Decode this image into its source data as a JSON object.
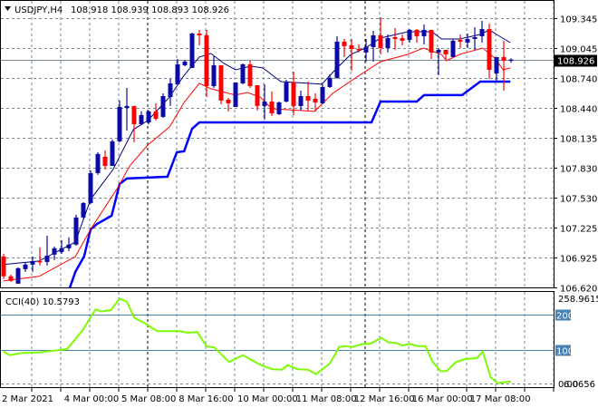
{
  "header": {
    "symbol": "USDJPY,H4",
    "ohlc": "108.918 108.939 108.893 108.926",
    "current_price": "108.926"
  },
  "colors": {
    "bull": "#0a0aa8",
    "bear": "#ff0000",
    "ma_fast": "#000080",
    "ma_slow": "#ff0000",
    "stop_line": "#0000ff",
    "cci": "#7cfc00",
    "level": "#4682b4",
    "grid": "#778899"
  },
  "chart_data": [
    {
      "type": "candlestick",
      "title": "USDJPY,H4",
      "yticks": [
        "109.345",
        "109.045",
        "108.740",
        "108.440",
        "108.135",
        "107.830",
        "107.530",
        "107.225",
        "106.925",
        "106.620"
      ],
      "ylim": [
        106.62,
        109.345
      ],
      "xticks": [
        "2 Mar 2021",
        "4 Mar 00:00",
        "5 Mar 08:00",
        "8 Mar 16:00",
        "10 Mar 00:00",
        "11 Mar 08:00",
        "12 Mar 16:00",
        "16 Mar 00:00",
        "17 Mar 08:00"
      ],
      "grid": true,
      "candles": [
        [
          106.933,
          106.961,
          106.704,
          106.732
        ],
        [
          106.732,
          106.75,
          106.677,
          106.686
        ],
        [
          106.658,
          106.823,
          106.658,
          106.814
        ],
        [
          106.805,
          106.869,
          106.777,
          106.851
        ],
        [
          106.851,
          106.933,
          106.777,
          106.887
        ],
        [
          106.887,
          107.025,
          106.842,
          106.878
        ],
        [
          106.878,
          107.144,
          106.842,
          106.942
        ],
        [
          106.952,
          107.034,
          106.897,
          107.016
        ],
        [
          106.979,
          107.098,
          106.961,
          107.016
        ],
        [
          107.016,
          107.126,
          106.988,
          107.053
        ],
        [
          107.053,
          107.355,
          107.043,
          107.328
        ],
        [
          107.328,
          107.483,
          107.319,
          107.474
        ],
        [
          107.474,
          107.804,
          107.465,
          107.777
        ],
        [
          107.777,
          107.988,
          107.759,
          107.97
        ],
        [
          107.942,
          108.006,
          107.814,
          107.85
        ],
        [
          107.85,
          108.116,
          107.85,
          108.098
        ],
        [
          108.098,
          108.511,
          108.089,
          108.446
        ],
        [
          108.437,
          108.639,
          108.208,
          108.456
        ],
        [
          108.456,
          108.456,
          108.089,
          108.272
        ],
        [
          108.272,
          108.401,
          108.263,
          108.364
        ],
        [
          108.29,
          108.41,
          108.272,
          108.401
        ],
        [
          108.401,
          108.483,
          108.309,
          108.327
        ],
        [
          108.346,
          108.584,
          108.336,
          108.556
        ],
        [
          108.547,
          108.731,
          108.456,
          108.685
        ],
        [
          108.676,
          108.932,
          108.676,
          108.877
        ],
        [
          108.868,
          108.923,
          108.859,
          108.905
        ],
        [
          108.841,
          109.198,
          108.841,
          109.189
        ],
        [
          109.189,
          109.226,
          109.07,
          109.171
        ],
        [
          109.171,
          109.226,
          108.547,
          108.657
        ],
        [
          108.657,
          108.96,
          108.639,
          108.868
        ],
        [
          108.868,
          108.868,
          108.474,
          108.511
        ],
        [
          108.52,
          108.538,
          108.401,
          108.483
        ],
        [
          108.446,
          108.694,
          108.446,
          108.694
        ],
        [
          108.685,
          108.886,
          108.676,
          108.877
        ],
        [
          108.877,
          108.914,
          108.639,
          108.657
        ],
        [
          108.666,
          108.666,
          108.41,
          108.456
        ],
        [
          108.456,
          108.676,
          108.318,
          108.501
        ],
        [
          108.501,
          108.602,
          108.355,
          108.382
        ],
        [
          108.373,
          108.501,
          108.364,
          108.492
        ],
        [
          108.501,
          108.721,
          108.492,
          108.694
        ],
        [
          108.694,
          108.804,
          108.364,
          108.456
        ],
        [
          108.456,
          108.611,
          108.41,
          108.556
        ],
        [
          108.556,
          108.703,
          108.41,
          108.511
        ],
        [
          108.529,
          108.584,
          108.401,
          108.492
        ],
        [
          108.483,
          108.676,
          108.474,
          108.648
        ],
        [
          108.648,
          108.777,
          108.639,
          108.74
        ],
        [
          108.74,
          109.162,
          108.731,
          109.107
        ],
        [
          109.107,
          109.134,
          108.951,
          109.061
        ],
        [
          109.07,
          109.134,
          108.813,
          109.033
        ],
        [
          109.033,
          109.079,
          108.997,
          109.024
        ],
        [
          108.997,
          109.134,
          108.905,
          109.052
        ],
        [
          109.052,
          109.217,
          108.905,
          109.171
        ],
        [
          109.171,
          109.354,
          108.978,
          109.042
        ],
        [
          109.042,
          109.18,
          108.997,
          109.143
        ],
        [
          109.152,
          109.244,
          109.024,
          109.134
        ],
        [
          109.143,
          109.18,
          109.07,
          109.116
        ],
        [
          109.125,
          109.235,
          109.097,
          109.226
        ],
        [
          109.226,
          109.235,
          109.097,
          109.162
        ],
        [
          109.162,
          109.281,
          109.079,
          109.226
        ],
        [
          109.226,
          109.226,
          108.932,
          108.997
        ],
        [
          108.997,
          109.042,
          108.767,
          109.024
        ],
        [
          109.024,
          109.024,
          108.914,
          108.978
        ],
        [
          108.951,
          109.134,
          108.951,
          109.116
        ],
        [
          109.125,
          109.18,
          109.042,
          109.107
        ],
        [
          109.097,
          109.189,
          109.042,
          109.134
        ],
        [
          109.134,
          109.253,
          109.024,
          109.152
        ],
        [
          109.162,
          109.317,
          109.097,
          109.235
        ],
        [
          109.235,
          109.29,
          108.731,
          108.822
        ],
        [
          108.786,
          108.951,
          108.703,
          108.951
        ],
        [
          108.951,
          109.116,
          108.611,
          108.914
        ],
        [
          108.918,
          108.939,
          108.893,
          108.926
        ]
      ],
      "xtick_index": [
        0,
        8.1,
        16,
        23.9,
        32,
        40.1,
        48.1,
        56.1,
        64.1
      ],
      "series": [
        {
          "name": "ma-fast",
          "points": [
            [
              0,
              106.851
            ],
            [
              4.9,
              106.887
            ],
            [
              9.9,
              107.08
            ],
            [
              12,
              107.511
            ],
            [
              15.1,
              107.814
            ],
            [
              17.9,
              108.217
            ],
            [
              19.9,
              108.309
            ],
            [
              22.9,
              108.547
            ],
            [
              24.9,
              108.767
            ],
            [
              27,
              108.951
            ],
            [
              28.6,
              108.987
            ],
            [
              30.4,
              108.886
            ],
            [
              32,
              108.822
            ],
            [
              34.1,
              108.859
            ],
            [
              35.75,
              108.841
            ],
            [
              38.25,
              108.703
            ],
            [
              42,
              108.685
            ],
            [
              43.9,
              108.676
            ],
            [
              45.75,
              108.822
            ],
            [
              47.9,
              108.978
            ],
            [
              49.9,
              109.042
            ],
            [
              52,
              109.143
            ],
            [
              55.75,
              109.207
            ],
            [
              59.1,
              109.207
            ],
            [
              60.4,
              109.134
            ],
            [
              62.9,
              109.134
            ],
            [
              65.75,
              109.18
            ],
            [
              67,
              109.226
            ],
            [
              68,
              109.18
            ],
            [
              69.9,
              109.097
            ]
          ]
        },
        {
          "name": "ma-slow",
          "points": [
            [
              0,
              106.686
            ],
            [
              4.9,
              106.732
            ],
            [
              9.9,
              106.933
            ],
            [
              12,
              107.208
            ],
            [
              15.75,
              107.63
            ],
            [
              17.4,
              107.85
            ],
            [
              19.9,
              108.061
            ],
            [
              22.9,
              108.245
            ],
            [
              24.9,
              108.492
            ],
            [
              27,
              108.685
            ],
            [
              28.6,
              108.63
            ],
            [
              32,
              108.566
            ],
            [
              33.6,
              108.593
            ],
            [
              35.4,
              108.547
            ],
            [
              37,
              108.428
            ],
            [
              42.9,
              108.401
            ],
            [
              45.4,
              108.584
            ],
            [
              49.1,
              108.767
            ],
            [
              52,
              108.905
            ],
            [
              55.75,
              108.978
            ],
            [
              57.9,
              109.042
            ],
            [
              60.4,
              108.978
            ],
            [
              61.1,
              108.914
            ],
            [
              62.9,
              108.978
            ],
            [
              66.1,
              109.042
            ],
            [
              67.9,
              108.932
            ],
            [
              68.9,
              108.822
            ],
            [
              69.9,
              108.841
            ]
          ]
        },
        {
          "name": "stop-line",
          "points": [
            [
              9.1,
              106.612
            ],
            [
              9.9,
              106.778
            ],
            [
              11.1,
              106.933
            ],
            [
              12,
              107.208
            ],
            [
              12.9,
              107.263
            ],
            [
              14.9,
              107.346
            ],
            [
              16,
              107.667
            ],
            [
              17,
              107.722
            ],
            [
              22.6,
              107.74
            ],
            [
              23.9,
              107.988
            ],
            [
              24.9,
              107.997
            ],
            [
              26,
              108.226
            ],
            [
              27,
              108.29
            ],
            [
              50.75,
              108.29
            ],
            [
              52,
              108.501
            ],
            [
              57,
              108.501
            ],
            [
              58,
              108.566
            ],
            [
              63.25,
              108.566
            ],
            [
              65.75,
              108.703
            ],
            [
              69.9,
              108.703
            ]
          ]
        }
      ]
    },
    {
      "type": "line",
      "title": "CCI(40) 10.5793",
      "label": "CCI(40)",
      "last_value": "10.5793",
      "ylim": [
        6.0656,
        258.9615
      ],
      "ytick_labels": {
        "max": "258.9615",
        "min": "6.0656",
        "zero": "0.00"
      },
      "levels": [
        {
          "value": 200,
          "label": "200"
        },
        {
          "value": 100,
          "label": "100"
        }
      ],
      "points": [
        [
          0,
          95.7
        ],
        [
          0.8,
          85.5
        ],
        [
          2.6,
          91.5
        ],
        [
          4.8,
          93
        ],
        [
          6.4,
          97
        ],
        [
          8.75,
          102.6
        ],
        [
          10.9,
          155.6
        ],
        [
          12.7,
          215
        ],
        [
          13.5,
          209
        ],
        [
          14.8,
          212.8
        ],
        [
          16,
          245
        ],
        [
          17,
          236.8
        ],
        [
          18,
          191.5
        ],
        [
          19.6,
          174
        ],
        [
          21.2,
          153
        ],
        [
          24.3,
          153
        ],
        [
          25.4,
          148.7
        ],
        [
          26.7,
          151
        ],
        [
          28,
          110
        ],
        [
          29.1,
          106.8
        ],
        [
          31.1,
          65.8
        ],
        [
          33,
          85.5
        ],
        [
          35.5,
          57.3
        ],
        [
          37,
          46
        ],
        [
          38.4,
          44.4
        ],
        [
          39.2,
          57.3
        ],
        [
          40.5,
          46
        ],
        [
          42,
          44.4
        ],
        [
          43.1,
          31.6
        ],
        [
          45,
          61.5
        ],
        [
          46.3,
          108.5
        ],
        [
          47.1,
          111
        ],
        [
          48.1,
          108.5
        ],
        [
          49.5,
          117
        ],
        [
          50.5,
          117
        ],
        [
          52.1,
          134
        ],
        [
          53.1,
          121.4
        ],
        [
          54.2,
          119.7
        ],
        [
          55,
          112.8
        ],
        [
          56.1,
          117
        ],
        [
          57.1,
          111
        ],
        [
          58.2,
          111
        ],
        [
          59.2,
          65.8
        ],
        [
          60.3,
          40
        ],
        [
          61.1,
          40
        ],
        [
          62.4,
          65.8
        ],
        [
          63.7,
          74.4
        ],
        [
          65.3,
          77
        ],
        [
          66.1,
          95.7
        ],
        [
          67.2,
          23
        ],
        [
          68.2,
          6.07
        ],
        [
          68.8,
          8
        ],
        [
          70,
          10.58
        ]
      ]
    }
  ]
}
